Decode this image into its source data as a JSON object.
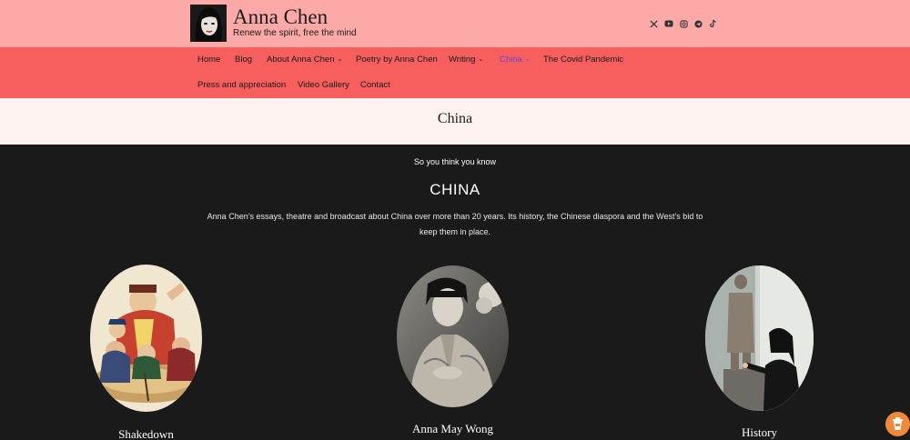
{
  "site": {
    "title": "Anna Chen",
    "tagline": "Renew the spirit, free the mind"
  },
  "social": [
    {
      "icon": "x-icon",
      "glyph": "𝕏"
    },
    {
      "icon": "youtube-icon"
    },
    {
      "icon": "instagram-icon"
    },
    {
      "icon": "telegram-icon"
    },
    {
      "icon": "tiktok-icon"
    }
  ],
  "nav": {
    "home": "Home",
    "blog": "Blog",
    "about": "About Anna Chen",
    "poetry": "Poetry by Anna Chen",
    "writing": "Writing",
    "china": "China",
    "covid": "The Covid Pandemic",
    "press": "Press and appreciation",
    "video": "Video Gallery",
    "contact": "Contact",
    "caret": "⌄"
  },
  "page": {
    "title": "China",
    "kicker": "So you think you know",
    "heading": "CHINA",
    "intro": "Anna Chen’s essays, theatre and broadcast about China over more than 20 years. Its history, the Chinese diaspora and the West’s bid to keep them in place."
  },
  "cards": [
    {
      "title": "Shakedown"
    },
    {
      "title": "Anna May Wong"
    },
    {
      "title": "History"
    }
  ],
  "colors": {
    "topbar": "#fda9a7",
    "navbar": "#f75e5e",
    "active_nav": "#6a45d8",
    "titlebar": "#fdf2ef",
    "main_bg": "#1a1a1a",
    "help_button": "#f08a3a"
  }
}
